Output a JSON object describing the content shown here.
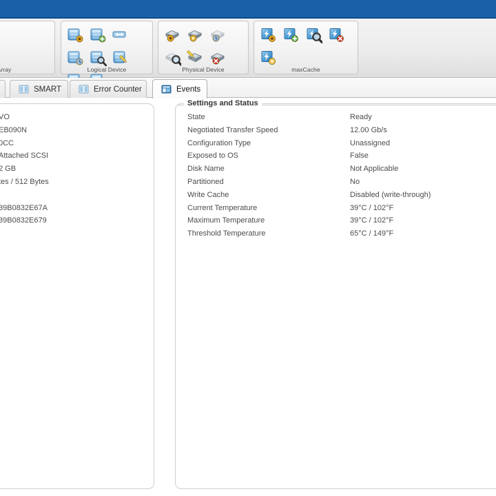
{
  "window": {
    "banner_color": "#1a60a8"
  },
  "ribbon": {
    "groups": [
      {
        "name": "array",
        "label": "Array",
        "icons": [
          "array-settings-icon",
          "array-locate-icon"
        ]
      },
      {
        "name": "logical-device",
        "label": "Logical Device",
        "icons": [
          "logical-device-settings-icon",
          "logical-device-create-icon",
          "logical-device-migrate-icon",
          "logical-device-verify-icon",
          "logical-device-locate-icon",
          "logical-device-modify-icon",
          "logical-device-delete-icon",
          "logical-device-cache-icon"
        ]
      },
      {
        "name": "physical-device",
        "label": "Physical Device",
        "icons": [
          "physical-device-settings-icon",
          "physical-device-force-fail-icon",
          "physical-device-verify-icon",
          "physical-device-locate-icon",
          "physical-device-initialize-icon",
          "physical-device-erase-icon"
        ]
      },
      {
        "name": "maxcache",
        "label": "maxCache",
        "icons": [
          "maxcache-settings-icon",
          "maxcache-create-icon",
          "maxcache-locate-icon",
          "maxcache-delete-icon",
          "maxcache-status-icon"
        ]
      }
    ]
  },
  "tabs": [
    {
      "label": "SMART",
      "icon": "smart-tab-icon",
      "active": false
    },
    {
      "label": "Error Counter",
      "icon": "error-counter-tab-icon",
      "active": false
    },
    {
      "label": "Events",
      "icon": "events-tab-icon",
      "active": true
    }
  ],
  "left_panel": {
    "clipped_rows": [
      "VO",
      "EB090N",
      "0CC",
      "Attached SCSI",
      "2 GB",
      "tes / 512 Bytes",
      "",
      "39B0832E67A",
      "39B0832E679"
    ]
  },
  "settings_and_status": {
    "legend": "Settings and Status",
    "rows": [
      {
        "label": "State",
        "value": "Ready"
      },
      {
        "label": "Negotiated Transfer Speed",
        "value": "12.00 Gb/s"
      },
      {
        "label": "Configuration Type",
        "value": "Unassigned"
      },
      {
        "label": "Exposed to OS",
        "value": "False"
      },
      {
        "label": "Disk Name",
        "value": "Not Applicable"
      },
      {
        "label": "Partitioned",
        "value": "No"
      },
      {
        "label": "Write Cache",
        "value": "Disabled (write-through)"
      },
      {
        "label": "Current Temperature",
        "value": "39°C / 102°F"
      },
      {
        "label": "Maximum Temperature",
        "value": "39°C / 102°F"
      },
      {
        "label": "Threshold Temperature",
        "value": "65°C / 149°F"
      }
    ]
  }
}
